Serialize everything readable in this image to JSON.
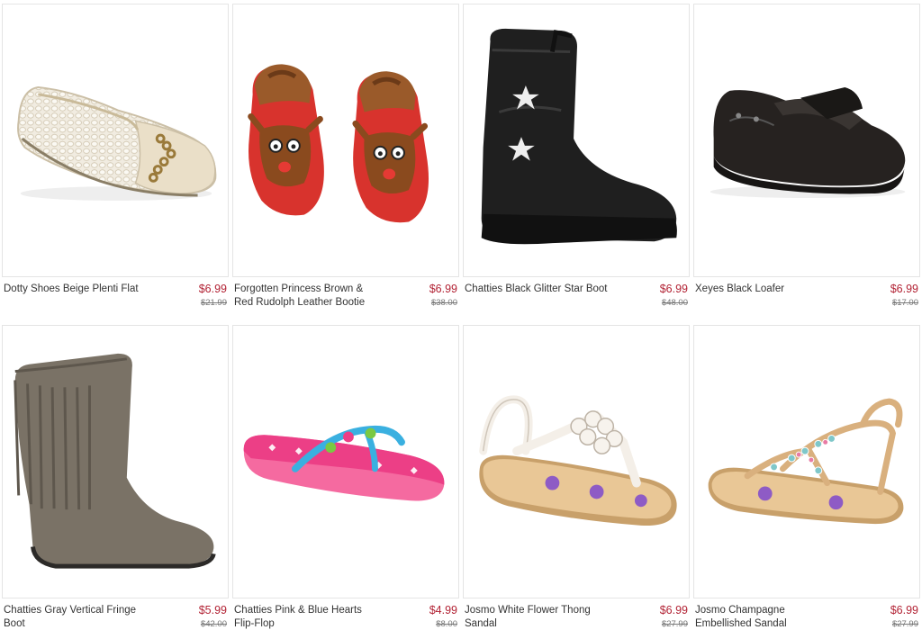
{
  "products": [
    {
      "name": "Dotty Shoes Beige Plenti Flat",
      "price": "$6.99",
      "original_price": "$21.99",
      "image": "beige-mesh-flat"
    },
    {
      "name": "Forgotten Princess Brown & Red Rudolph Leather Bootie",
      "price": "$6.99",
      "original_price": "$38.00",
      "image": "red-reindeer-booties"
    },
    {
      "name": "Chatties Black Glitter Star Boot",
      "price": "$6.99",
      "original_price": "$48.00",
      "image": "black-star-cowboy-boot"
    },
    {
      "name": "Xeyes Black Loafer",
      "price": "$6.99",
      "original_price": "$17.00",
      "image": "black-velcro-loafer"
    },
    {
      "name": "Chatties Gray Vertical Fringe Boot",
      "price": "$5.99",
      "original_price": "$42.00",
      "image": "gray-fringe-boot"
    },
    {
      "name": "Chatties Pink & Blue Hearts Flip-Flop",
      "price": "$4.99",
      "original_price": "$8.00",
      "image": "pink-heart-flip-flop"
    },
    {
      "name": "Josmo White Flower Thong Sandal",
      "price": "$6.99",
      "original_price": "$27.99",
      "image": "white-flower-sandal"
    },
    {
      "name": "Josmo Champagne Embellished Sandal",
      "price": "$6.99",
      "original_price": "$27.99",
      "image": "champagne-jeweled-sandal"
    }
  ]
}
